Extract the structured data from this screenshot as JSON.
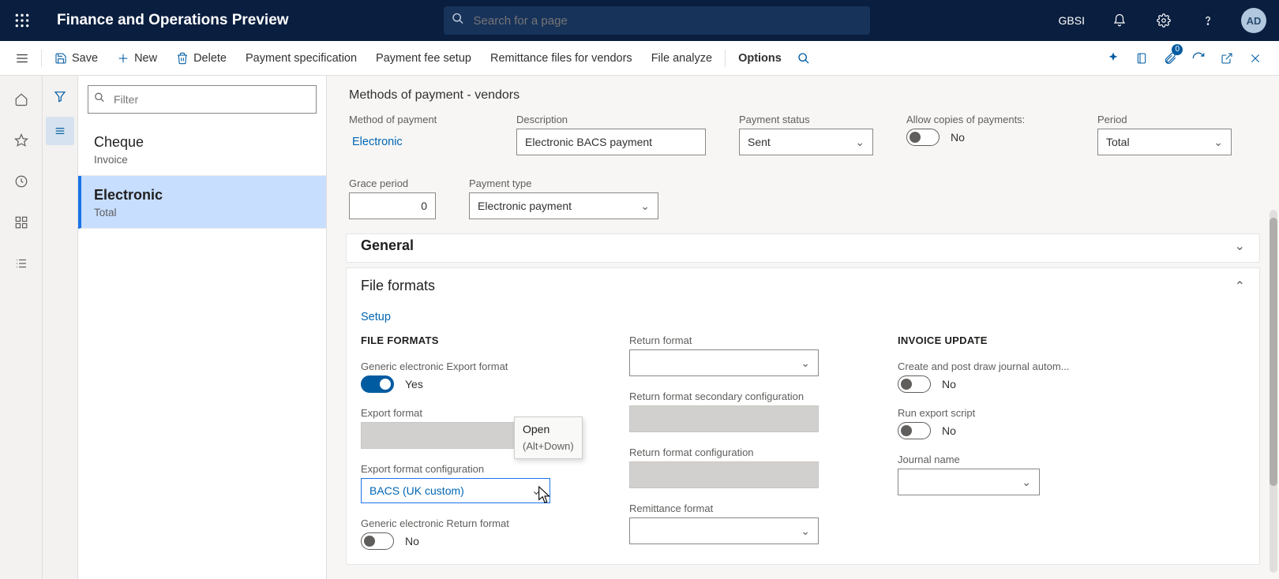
{
  "topbar": {
    "product": "Finance and Operations Preview",
    "search_placeholder": "Search for a page",
    "company": "GBSI",
    "avatar": "AD"
  },
  "actions": {
    "save": "Save",
    "new": "New",
    "delete": "Delete",
    "pay_spec": "Payment specification",
    "pay_fee": "Payment fee setup",
    "remittance": "Remittance files for vendors",
    "file_analyze": "File analyze",
    "options": "Options",
    "attach_badge": "0"
  },
  "sidepanel": {
    "filter_placeholder": "Filter",
    "items": [
      {
        "name": "Cheque",
        "sub": "Invoice"
      },
      {
        "name": "Electronic",
        "sub": "Total"
      }
    ]
  },
  "page": {
    "title": "Methods of payment - vendors"
  },
  "header": {
    "method_of_payment": {
      "label": "Method of payment",
      "value": "Electronic"
    },
    "description": {
      "label": "Description",
      "value": "Electronic BACS payment"
    },
    "payment_status": {
      "label": "Payment status",
      "value": "Sent"
    },
    "allow_copies": {
      "label": "Allow copies of payments:",
      "value": "No"
    },
    "period": {
      "label": "Period",
      "value": "Total"
    },
    "grace": {
      "label": "Grace period",
      "value": "0"
    },
    "payment_type": {
      "label": "Payment type",
      "value": "Electronic payment"
    }
  },
  "tabs": {
    "general": "General",
    "file_formats": "File formats"
  },
  "file_formats": {
    "setup": "Setup",
    "grp1": "FILE FORMATS",
    "generic_export": {
      "label": "Generic electronic Export format",
      "value": "Yes"
    },
    "export_format": {
      "label": "Export format"
    },
    "export_config": {
      "label": "Export format configuration",
      "value": "BACS (UK custom)"
    },
    "generic_return": {
      "label": "Generic electronic Return format",
      "value": "No"
    },
    "return_format": {
      "label": "Return format"
    },
    "return_sec": {
      "label": "Return format secondary configuration"
    },
    "return_config": {
      "label": "Return format configuration"
    },
    "remittance_format": {
      "label": "Remittance format"
    },
    "grp3": "INVOICE UPDATE",
    "create_post": {
      "label": "Create and post draw journal autom...",
      "value": "No"
    },
    "run_export": {
      "label": "Run export script",
      "value": "No"
    },
    "journal": {
      "label": "Journal name"
    }
  },
  "tooltip": {
    "line1": "Open",
    "line2": "(Alt+Down)"
  }
}
